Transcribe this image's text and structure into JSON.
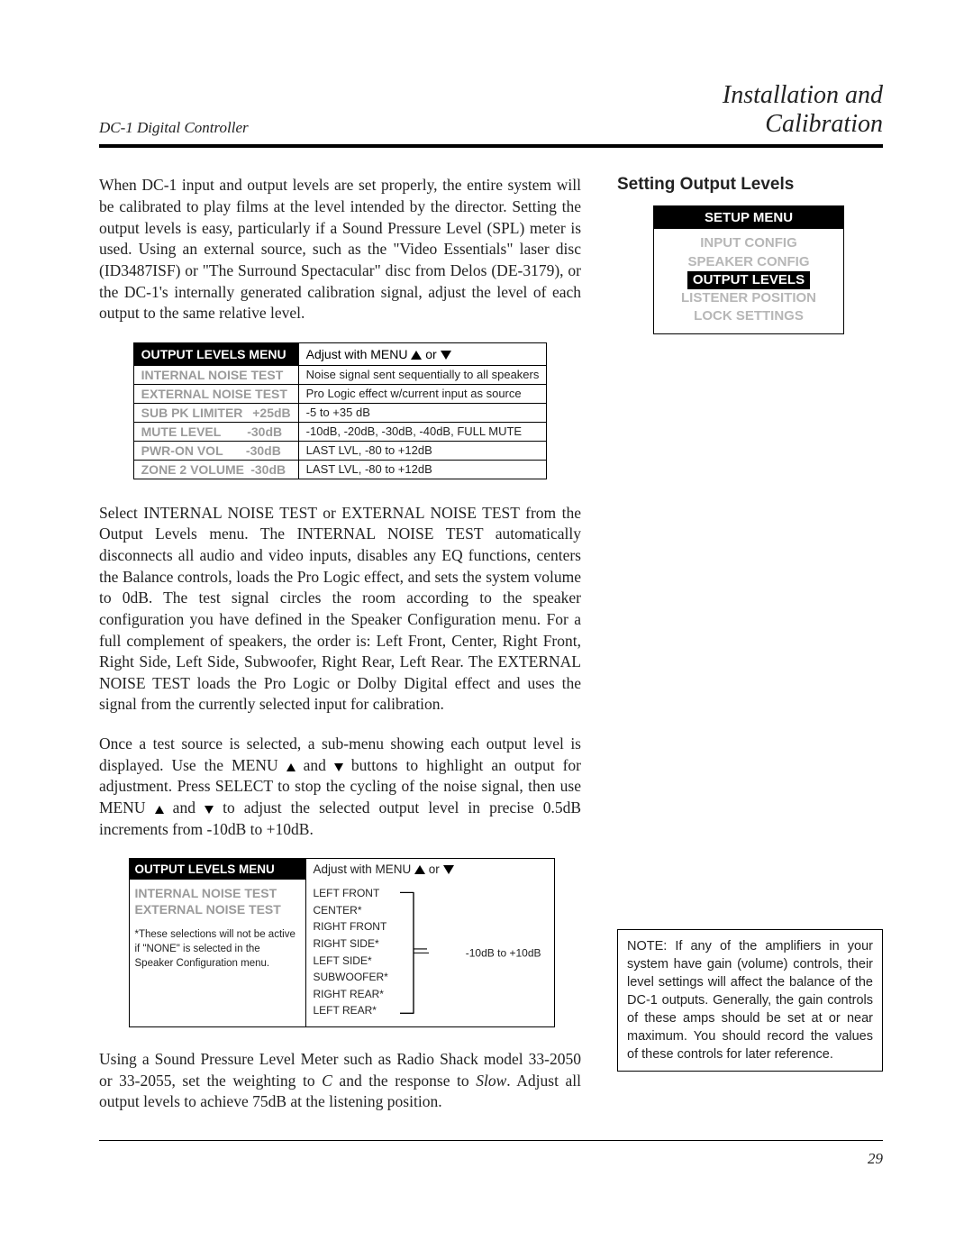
{
  "header": {
    "product": "DC-1 Digital Controller",
    "chapter_line1": "Installation and",
    "chapter_line2": "Calibration"
  },
  "side": {
    "section_title": "Setting Output Levels",
    "setup_menu": {
      "title": "SETUP MENU",
      "items": [
        "INPUT CONFIG",
        "SPEAKER CONFIG",
        "OUTPUT LEVELS",
        "LISTENER POSITION",
        "LOCK SETTINGS"
      ],
      "selected_index": 2
    },
    "note_box": "NOTE: If any of the amplifiers in your system have gain (volume) controls, their level settings will affect the balance of the DC-1 outputs. Generally, the gain controls of these amps should be set at or near maximum. You should record the values of these controls for later reference."
  },
  "main": {
    "p1": "When DC-1 input and output levels are set properly, the entire system will be calibrated to play films at the level intended by the director. Setting the output levels is easy, particularly if a Sound Pressure Level (SPL) meter is used. Using an external source, such as the \"Video Essentials\" laser disc (ID3487ISF) or \"The Surround Spectacular\" disc from Delos (DE-3179), or the DC-1's internally generated calibration signal, adjust the level of each output to the same relative level.",
    "fig1": {
      "left_head": "OUTPUT LEVELS MENU",
      "right_head_prefix": "Adjust with MENU ",
      "right_head_suffix": " or ",
      "rows": [
        {
          "name": "INTERNAL NOISE TEST",
          "val": "",
          "desc": "Noise signal sent sequentially to all speakers"
        },
        {
          "name": "EXTERNAL NOISE TEST",
          "val": "",
          "desc": "Pro Logic effect w/current input as source"
        },
        {
          "name": "SUB PK LIMITER",
          "val": "+25dB",
          "desc": "-5 to +35 dB"
        },
        {
          "name": "MUTE LEVEL",
          "val": "-30dB",
          "desc": "-10dB, -20dB, -30dB, -40dB, FULL MUTE"
        },
        {
          "name": "PWR-ON VOL",
          "val": "-30dB",
          "desc": "LAST LVL, -80 to +12dB"
        },
        {
          "name": "ZONE 2 VOLUME",
          "val": "-30dB",
          "desc": "LAST LVL, -80 to +12dB"
        }
      ]
    },
    "p2": "Select INTERNAL NOISE TEST or EXTERNAL NOISE TEST from the Output Levels menu. The INTERNAL NOISE TEST automatically disconnects all audio and video inputs, disables any EQ functions, centers the Balance controls, loads the Pro Logic effect, and sets the system volume to 0dB. The test signal circles the room according to the speaker configuration you have defined in the Speaker Configuration menu. For a full complement of speakers, the order is: Left Front, Center, Right Front, Right Side, Left Side, Subwoofer, Right Rear, Left Rear. The  EXTERNAL NOISE TEST loads the Pro Logic or Dolby Digital effect and uses the signal from the currently selected input for calibration.",
    "p3a": "Once a test source is selected, a sub-menu showing each output level is displayed. Use the MENU ",
    "p3b": " and ",
    "p3c": " buttons  to highlight an output for adjustment.  Press SELECT to stop the cycling of the noise signal, then use MENU ",
    "p3d": " and ",
    "p3e": " to adjust the selected output level in precise 0.5dB increments from -10dB to +10dB.",
    "fig2": {
      "left_head": "OUTPUT LEVELS MENU",
      "left_items": [
        "INTERNAL NOISE TEST",
        "EXTERNAL NOISE TEST"
      ],
      "left_note": "*These selections will not be active if \"NONE\" is selected in the Speaker Configuration menu.",
      "right_head_prefix": "Adjust with MENU ",
      "right_head_suffix": " or ",
      "speakers": [
        "LEFT FRONT",
        "CENTER*",
        "RIGHT FRONT",
        "RIGHT SIDE*",
        "LEFT SIDE*",
        "SUBWOOFER*",
        "RIGHT REAR*",
        "LEFT REAR*"
      ],
      "range": "-10dB to +10dB"
    },
    "p4a": "Using a Sound Pressure Level Meter such as Radio Shack model 33-2050 or 33-2055, set the weighting to ",
    "p4_i1": "C",
    "p4b": "  and the response to ",
    "p4_i2": "Slow",
    "p4c": ". Adjust all output levels to achieve 75dB at the listening position."
  },
  "footer": {
    "page_number": "29"
  }
}
